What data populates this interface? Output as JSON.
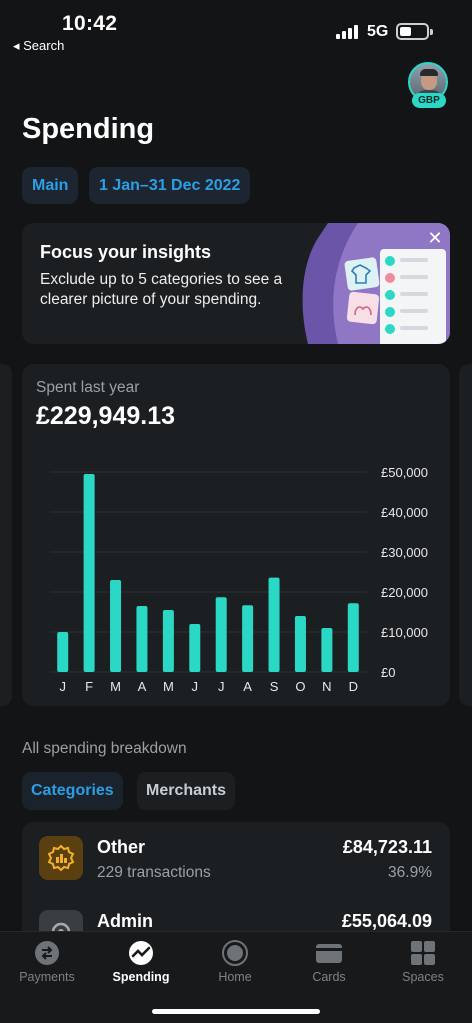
{
  "status_bar": {
    "time": "10:42",
    "back_label": "◂ Search",
    "network": "5G"
  },
  "avatar": {
    "currency_badge": "GBP"
  },
  "page": {
    "title": "Spending"
  },
  "filters": {
    "account": "Main",
    "date_range": "1 Jan–31 Dec 2022"
  },
  "insight_card": {
    "title": "Focus your insights",
    "body": "Exclude up to 5 categories to see a clearer picture of your spending.",
    "close_icon": "close-icon"
  },
  "spend_summary": {
    "label": "Spent last year",
    "total": "£229,949.13"
  },
  "chart_data": {
    "type": "bar",
    "categories": [
      "J",
      "F",
      "M",
      "A",
      "M",
      "J",
      "J",
      "A",
      "S",
      "O",
      "N",
      "D"
    ],
    "values": [
      10000,
      49500,
      23000,
      16500,
      15500,
      12000,
      18700,
      16700,
      23600,
      14000,
      11000,
      17200
    ],
    "yticks": [
      "£50,000",
      "£40,000",
      "£30,000",
      "£20,000",
      "£10,000",
      "£0"
    ],
    "ylim": [
      0,
      50000
    ],
    "bar_color": "#2bd8c5",
    "grid": true
  },
  "breakdown": {
    "label": "All spending breakdown",
    "tabs": [
      {
        "label": "Categories",
        "active": true
      },
      {
        "label": "Merchants",
        "active": false
      }
    ],
    "items": [
      {
        "name": "Other",
        "transactions": "229 transactions",
        "amount": "£84,723.11",
        "percent": "36.9%",
        "icon": "other-category-icon",
        "color": "#e6a21c"
      },
      {
        "name": "Admin",
        "transactions": "",
        "amount": "£55,064.09",
        "percent": "",
        "icon": "gear-icon",
        "color": "#8a8f94"
      }
    ]
  },
  "tab_bar": {
    "items": [
      {
        "label": "Payments",
        "icon": "payments-icon",
        "active": false
      },
      {
        "label": "Spending",
        "icon": "spending-icon",
        "active": true
      },
      {
        "label": "Home",
        "icon": "home-icon",
        "active": false
      },
      {
        "label": "Cards",
        "icon": "cards-icon",
        "active": false
      },
      {
        "label": "Spaces",
        "icon": "spaces-icon",
        "active": false
      }
    ]
  }
}
